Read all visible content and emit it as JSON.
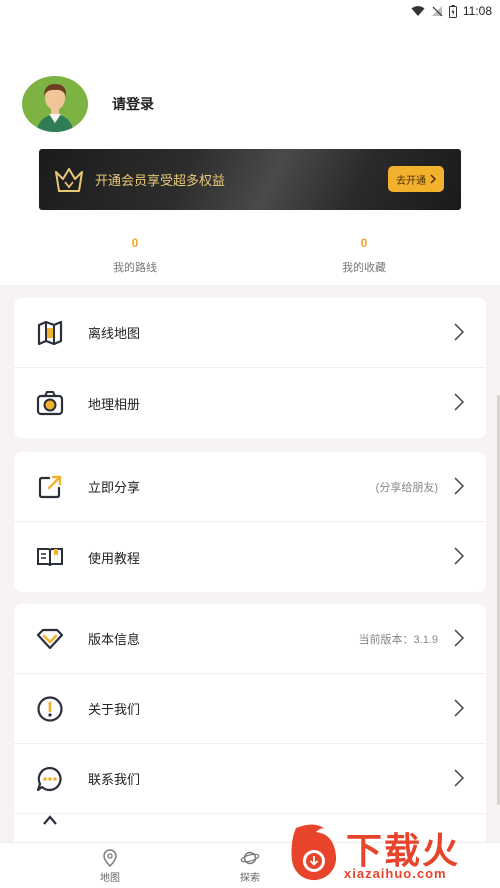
{
  "status_bar": {
    "time": "11:08"
  },
  "profile": {
    "login_text": "请登录"
  },
  "vip_banner": {
    "text": "开通会员享受超多权益",
    "button_label": "去开通"
  },
  "stats": [
    {
      "count": "0",
      "label": "我的路线"
    },
    {
      "count": "0",
      "label": "我的收藏"
    }
  ],
  "menu_groups": [
    {
      "items": [
        {
          "label": "离线地图",
          "icon": "map-icon"
        },
        {
          "label": "地理相册",
          "icon": "camera-icon"
        }
      ]
    },
    {
      "items": [
        {
          "label": "立即分享",
          "icon": "share-icon",
          "extra": "(分享给朋友)"
        },
        {
          "label": "使用教程",
          "icon": "book-icon"
        }
      ]
    },
    {
      "items": [
        {
          "label": "版本信息",
          "icon": "diamond-icon",
          "extra": "当前版本：3.1.9"
        },
        {
          "label": "关于我们",
          "icon": "info-icon"
        },
        {
          "label": "联系我们",
          "icon": "chat-icon"
        }
      ]
    }
  ],
  "tabs": [
    {
      "label": "地图",
      "icon": "map-pin-icon"
    },
    {
      "label": "探索",
      "icon": "planet-icon"
    }
  ],
  "watermark": {
    "main": "下载火",
    "sub": "xiazaihuo.com"
  },
  "colors": {
    "accent": "#f2b22e",
    "page_bg": "#f7f3f2",
    "watermark": "#e8442c"
  }
}
